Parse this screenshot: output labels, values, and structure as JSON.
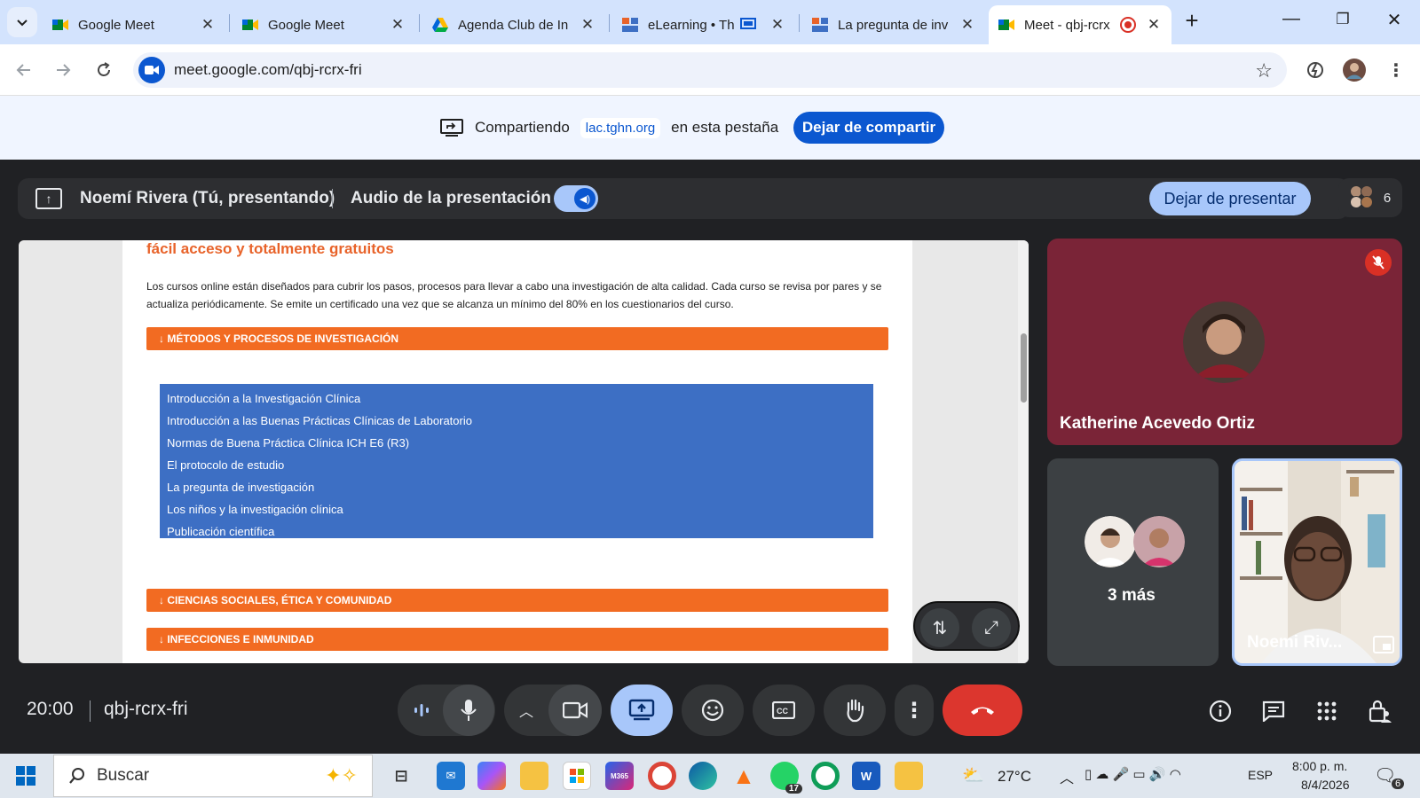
{
  "browser": {
    "tabs": [
      {
        "title": "Google Meet",
        "icon": "meet-icon"
      },
      {
        "title": "Google Meet",
        "icon": "meet-icon"
      },
      {
        "title": "Agenda Club de In",
        "icon": "drive-icon"
      },
      {
        "title": "eLearning • Th",
        "icon": "sites-icon"
      },
      {
        "title": "La pregunta de inv",
        "icon": "sites-icon"
      },
      {
        "title": "Meet - qbj-rcrx",
        "icon": "meet-icon",
        "active": true
      }
    ],
    "url": "meet.google.com/qbj-rcrx-fri"
  },
  "sharing": {
    "label": "Compartiendo",
    "site": "lac.tghn.org",
    "suffix": "en esta pestaña",
    "stop_label": "Dejar de compartir"
  },
  "presentation": {
    "presenter": "Noemí Rivera (Tú, presentando)",
    "audio_label": "Audio de la presentación",
    "stop_label": "Dejar de presentar",
    "participant_count": "6"
  },
  "shared_page": {
    "heading": "fácil acceso y totalmente gratuitos",
    "paragraph": "Los cursos online están diseñados para cubrir los pasos, procesos  para llevar a cabo una investigación de alta calidad. Cada curso se revisa por pares y se actualiza periódicamente. Se emite un certificado una vez que se alcanza un mínimo del 80% en los cuestionarios del curso.",
    "sections": [
      "↓ MÉTODOS Y PROCESOS DE INVESTIGACIÓN",
      "↓ CIENCIAS SOCIALES, ÉTICA Y COMUNIDAD",
      "↓ INFECCIONES E INMUNIDAD"
    ],
    "courses": [
      "Introducción a la Investigación Clínica",
      "Introducción a las Buenas Prácticas Clínicas de Laboratorio",
      "Normas de Buena Práctica Clínica ICH E6 (R3)",
      "El protocolo de estudio",
      "La pregunta de investigación",
      "Los niños y la investigación clínica",
      "Publicación científica"
    ]
  },
  "tiles": {
    "katherine": "Katherine Acevedo Ortiz",
    "more": "3 más",
    "self": "Noemi Riv..."
  },
  "meeting": {
    "time": "20:00",
    "code": "qbj-rcrx-fri"
  },
  "taskbar": {
    "search_placeholder": "Buscar",
    "weather": "27°C",
    "whatsapp_badge": "17",
    "language": "ESP",
    "time": "8:00 p. m.",
    "date": "8/4/2026",
    "notifications": "6"
  },
  "colors": {
    "accent": "#0b57d0",
    "orange": "#f26b22",
    "course_blue": "#3d6fc4",
    "hangup": "#d93025",
    "tile_bg": "#7a2437"
  }
}
